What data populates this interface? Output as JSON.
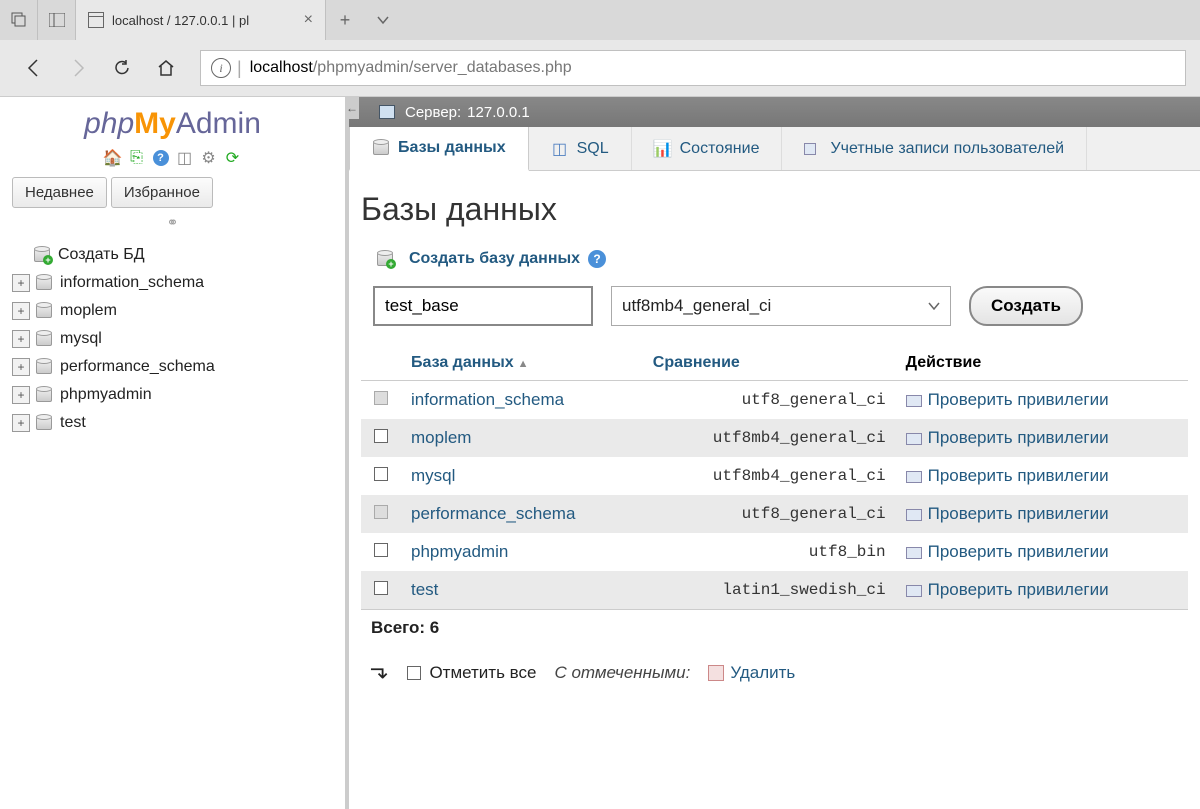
{
  "browser": {
    "tab_title": "localhost / 127.0.0.1 | pl",
    "url_domain": "localhost",
    "url_path": "/phpmyadmin/server_databases.php"
  },
  "logo": {
    "php": "php",
    "my": "My",
    "admin": "Admin"
  },
  "sidebar": {
    "tabs": [
      "Недавнее",
      "Избранное"
    ],
    "create_db": "Создать БД",
    "dbs": [
      "information_schema",
      "moplem",
      "mysql",
      "performance_schema",
      "phpmyadmin",
      "test"
    ]
  },
  "breadcrumb": {
    "label": "Сервер:",
    "value": "127.0.0.1"
  },
  "top_tabs": [
    "Базы данных",
    "SQL",
    "Состояние",
    "Учетные записи пользователей"
  ],
  "page_title": "Базы данных",
  "create": {
    "label": "Создать базу данных",
    "name_value": "test_base",
    "collation_value": "utf8mb4_general_ci",
    "button": "Создать"
  },
  "table": {
    "headers": {
      "db": "База данных",
      "coll": "Сравнение",
      "action": "Действие"
    },
    "rows": [
      {
        "name": "information_schema",
        "coll": "utf8_general_ci",
        "priv": "Проверить привилегии",
        "checkable": false
      },
      {
        "name": "moplem",
        "coll": "utf8mb4_general_ci",
        "priv": "Проверить привилегии",
        "checkable": true
      },
      {
        "name": "mysql",
        "coll": "utf8mb4_general_ci",
        "priv": "Проверить привилегии",
        "checkable": true
      },
      {
        "name": "performance_schema",
        "coll": "utf8_general_ci",
        "priv": "Проверить привилегии",
        "checkable": false
      },
      {
        "name": "phpmyadmin",
        "coll": "utf8_bin",
        "priv": "Проверить привилегии",
        "checkable": true
      },
      {
        "name": "test",
        "coll": "latin1_swedish_ci",
        "priv": "Проверить привилегии",
        "checkable": true
      }
    ],
    "total_label": "Всего: 6"
  },
  "bulk": {
    "check_all": "Отметить все",
    "with_selected": "С отмеченными:",
    "delete": "Удалить"
  }
}
